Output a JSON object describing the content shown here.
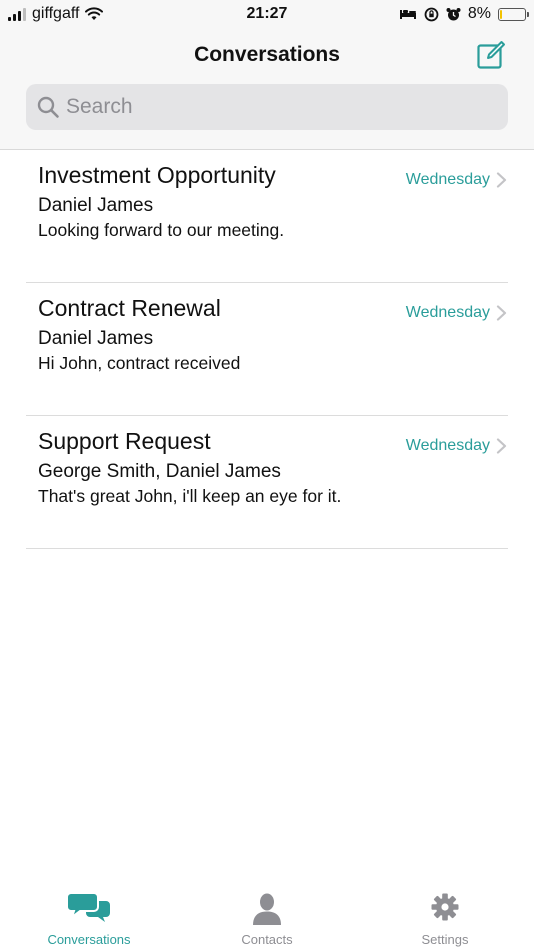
{
  "status_bar": {
    "carrier": "giffgaff",
    "time": "21:27",
    "battery": "8%",
    "battery_level": 0.08
  },
  "header": {
    "title": "Conversations",
    "compose_icon": "compose-icon"
  },
  "search": {
    "placeholder": "Search"
  },
  "conversations": [
    {
      "title": "Investment Opportunity",
      "participants": "Daniel James",
      "preview": "Looking forward to our meeting.",
      "date": "Wednesday"
    },
    {
      "title": "Contract Renewal",
      "participants": "Daniel James",
      "preview": "Hi John, contract received",
      "date": "Wednesday"
    },
    {
      "title": "Support Request",
      "participants": "George Smith, Daniel James",
      "preview": "That's great John, i'll keep an eye for it.",
      "date": "Wednesday"
    }
  ],
  "tabbar": {
    "tabs": [
      {
        "label": "Conversations",
        "icon": "chat-bubbles-icon",
        "active": true
      },
      {
        "label": "Contacts",
        "icon": "person-icon",
        "active": false
      },
      {
        "label": "Settings",
        "icon": "gear-icon",
        "active": false
      }
    ]
  },
  "colors": {
    "accent": "#2a9d9a",
    "muted": "#8e8e93",
    "bar_background": "#f7f7f7"
  }
}
